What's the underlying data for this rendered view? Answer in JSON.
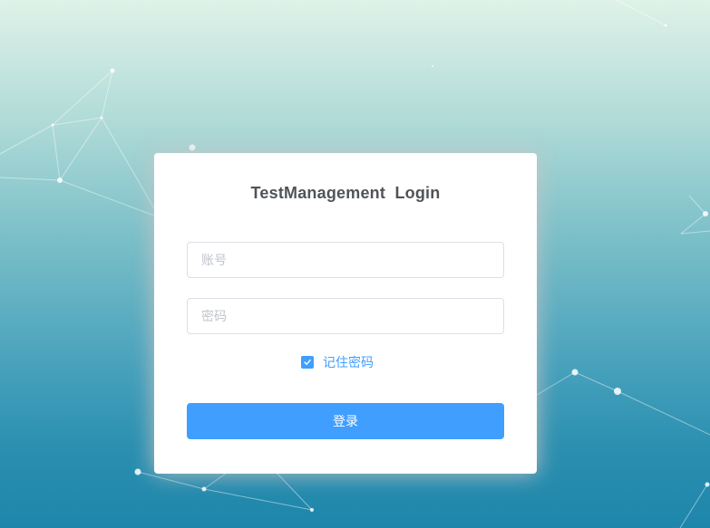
{
  "login": {
    "title": "TestManagement  Login",
    "username_placeholder": "账号",
    "password_placeholder": "密码",
    "remember_label": "记住密码",
    "remember_checked": true,
    "submit_label": "登录"
  },
  "colors": {
    "accent": "#409eff",
    "title_text": "#505458",
    "input_border": "#dcdfe6",
    "placeholder": "#c0c4cc",
    "card_background": "#ffffff"
  },
  "icons": {
    "checkbox_mark": "checkmark-icon"
  }
}
